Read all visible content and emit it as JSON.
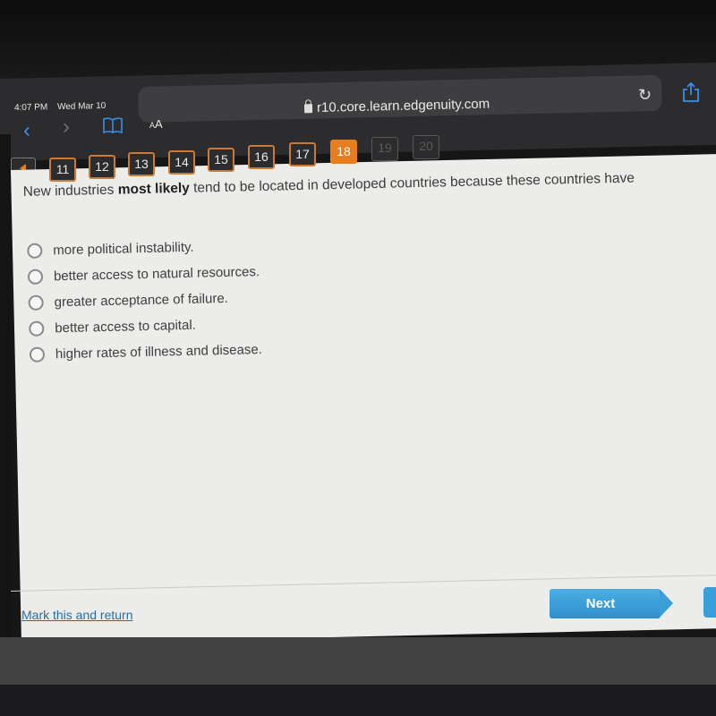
{
  "status_bar": {
    "time": "4:07 PM",
    "date": "Wed Mar 10"
  },
  "browser": {
    "text_size_label_small": "A",
    "text_size_label_large": "A",
    "url": "r10.core.learn.edgenuity.com",
    "icons": {
      "back": "chevron-left-icon",
      "forward": "chevron-right-icon",
      "bookmarks": "book-icon",
      "lock": "lock-icon",
      "reload": "reload-icon",
      "share": "share-icon"
    },
    "accent_color": "#3a8ee6"
  },
  "question_nav": {
    "prev_icon": "triangle-left-icon",
    "current": "18",
    "items": [
      {
        "label": "11",
        "state": "visited"
      },
      {
        "label": "12",
        "state": "visited"
      },
      {
        "label": "13",
        "state": "visited"
      },
      {
        "label": "14",
        "state": "visited"
      },
      {
        "label": "15",
        "state": "visited"
      },
      {
        "label": "16",
        "state": "visited"
      },
      {
        "label": "17",
        "state": "visited"
      },
      {
        "label": "18",
        "state": "active"
      },
      {
        "label": "19",
        "state": "disabled"
      },
      {
        "label": "20",
        "state": "disabled"
      }
    ],
    "active_color": "#e87d1e"
  },
  "question": {
    "prefix": "New industries ",
    "emphasis": "most likely",
    "suffix": " tend to be located in developed countries because these countries have",
    "options": [
      {
        "label": "more political instability.",
        "selected": false
      },
      {
        "label": "better access to natural resources.",
        "selected": false
      },
      {
        "label": "greater acceptance of failure.",
        "selected": false
      },
      {
        "label": "better access to capital.",
        "selected": false
      },
      {
        "label": "higher rates of illness and disease.",
        "selected": false
      }
    ]
  },
  "footer": {
    "mark_link": "Mark this and return",
    "next_label": "Next",
    "next_color": "#3a9ed8"
  }
}
